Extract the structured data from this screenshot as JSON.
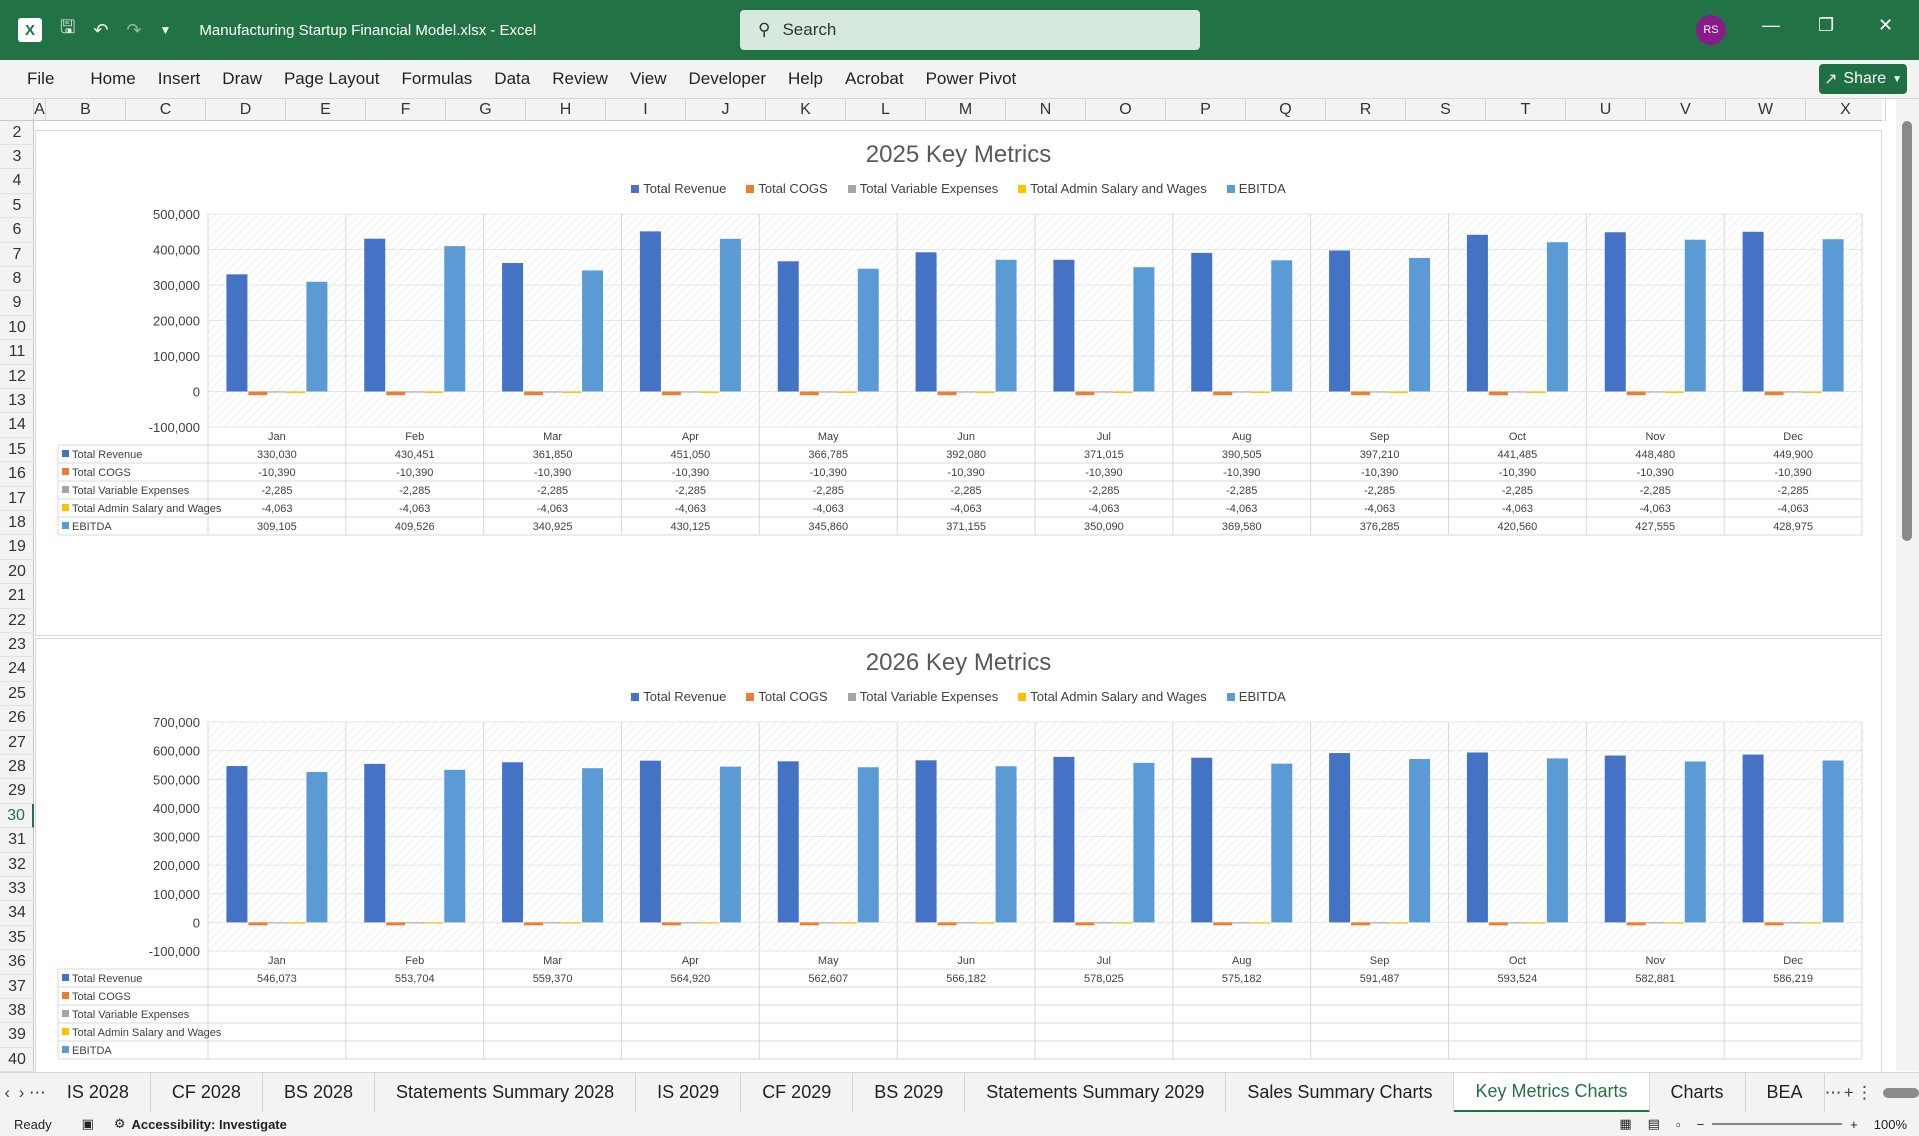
{
  "titlebar": {
    "file_title": "Manufacturing Startup Financial Model.xlsx  -  Excel",
    "search_placeholder": "Search",
    "avatar_initials": "RS"
  },
  "ribbon": {
    "tabs": [
      "File",
      "Home",
      "Insert",
      "Draw",
      "Page Layout",
      "Formulas",
      "Data",
      "Review",
      "View",
      "Developer",
      "Help",
      "Acrobat",
      "Power Pivot"
    ],
    "share_label": "Share"
  },
  "columns": [
    "A",
    "B",
    "C",
    "D",
    "E",
    "F",
    "G",
    "H",
    "I",
    "J",
    "K",
    "L",
    "M",
    "N",
    "O",
    "P",
    "Q",
    "R",
    "S",
    "T",
    "U",
    "V",
    "W",
    "X"
  ],
  "rows": [
    "2",
    "3",
    "4",
    "5",
    "6",
    "7",
    "8",
    "9",
    "10",
    "11",
    "12",
    "13",
    "14",
    "15",
    "16",
    "17",
    "18",
    "19",
    "20",
    "21",
    "22",
    "23",
    "24",
    "25",
    "26",
    "27",
    "28",
    "29",
    "30",
    "31",
    "32",
    "33",
    "34",
    "35",
    "36",
    "37",
    "38",
    "39",
    "40"
  ],
  "selected_row": "30",
  "colors": {
    "revenue": "#4472c4",
    "cogs": "#ed7d31",
    "variable": "#a5a5a5",
    "admin": "#ffc000",
    "ebitda": "#5b9bd5",
    "excel_green": "#217346"
  },
  "chart_data": [
    {
      "type": "bar",
      "title": "2025 Key Metrics",
      "categories": [
        "Jan",
        "Feb",
        "Mar",
        "Apr",
        "May",
        "Jun",
        "Jul",
        "Aug",
        "Sep",
        "Oct",
        "Nov",
        "Dec"
      ],
      "ylim": [
        -100000,
        500000
      ],
      "yticks": [
        "500,000",
        "400,000",
        "300,000",
        "200,000",
        "100,000",
        "0",
        "-100,000"
      ],
      "legend_position": "top",
      "series": [
        {
          "name": "Total Revenue",
          "values": [
            330030,
            430451,
            361850,
            451050,
            366785,
            392080,
            371015,
            390505,
            397210,
            441485,
            448480,
            449900
          ],
          "labels": [
            "330,030",
            "430,451",
            "361,850",
            "451,050",
            "366,785",
            "392,080",
            "371,015",
            "390,505",
            "397,210",
            "441,485",
            "448,480",
            "449,900"
          ]
        },
        {
          "name": "Total COGS",
          "values": [
            -10390,
            -10390,
            -10390,
            -10390,
            -10390,
            -10390,
            -10390,
            -10390,
            -10390,
            -10390,
            -10390,
            -10390
          ],
          "labels": [
            "-10,390",
            "-10,390",
            "-10,390",
            "-10,390",
            "-10,390",
            "-10,390",
            "-10,390",
            "-10,390",
            "-10,390",
            "-10,390",
            "-10,390",
            "-10,390"
          ]
        },
        {
          "name": "Total Variable Expenses",
          "values": [
            -2285,
            -2285,
            -2285,
            -2285,
            -2285,
            -2285,
            -2285,
            -2285,
            -2285,
            -2285,
            -2285,
            -2285
          ],
          "labels": [
            "-2,285",
            "-2,285",
            "-2,285",
            "-2,285",
            "-2,285",
            "-2,285",
            "-2,285",
            "-2,285",
            "-2,285",
            "-2,285",
            "-2,285",
            "-2,285"
          ]
        },
        {
          "name": "Total Admin Salary and Wages",
          "values": [
            -4063,
            -4063,
            -4063,
            -4063,
            -4063,
            -4063,
            -4063,
            -4063,
            -4063,
            -4063,
            -4063,
            -4063
          ],
          "labels": [
            "-4,063",
            "-4,063",
            "-4,063",
            "-4,063",
            "-4,063",
            "-4,063",
            "-4,063",
            "-4,063",
            "-4,063",
            "-4,063",
            "-4,063",
            "-4,063"
          ]
        },
        {
          "name": "EBITDA",
          "values": [
            309105,
            409526,
            340925,
            430125,
            345860,
            371155,
            350090,
            369580,
            376285,
            420560,
            427555,
            428975
          ],
          "labels": [
            "309,105",
            "409,526",
            "340,925",
            "430,125",
            "345,860",
            "371,155",
            "350,090",
            "369,580",
            "376,285",
            "420,560",
            "427,555",
            "428,975"
          ]
        }
      ]
    },
    {
      "type": "bar",
      "title": "2026 Key Metrics",
      "categories": [
        "Jan",
        "Feb",
        "Mar",
        "Apr",
        "May",
        "Jun",
        "Jul",
        "Aug",
        "Sep",
        "Oct",
        "Nov",
        "Dec"
      ],
      "ylim": [
        -100000,
        700000
      ],
      "yticks": [
        "700,000",
        "600,000",
        "500,000",
        "400,000",
        "300,000",
        "200,000",
        "100,000",
        "0",
        "-100,000"
      ],
      "legend_position": "top",
      "series": [
        {
          "name": "Total Revenue",
          "values": [
            546073,
            553704,
            559370,
            564920,
            562607,
            566182,
            578025,
            575182,
            591487,
            593524,
            582881,
            586219
          ],
          "labels": [
            "546,073",
            "553,704",
            "559,370",
            "564,920",
            "562,607",
            "566,182",
            "578,025",
            "575,182",
            "591,487",
            "593,524",
            "582,881",
            "586,219"
          ]
        },
        {
          "name": "Total COGS",
          "values": [
            -10390,
            -10390,
            -10390,
            -10390,
            -10390,
            -10390,
            -10390,
            -10390,
            -10390,
            -10390,
            -10390,
            -10390
          ],
          "labels": []
        },
        {
          "name": "Total Variable Expenses",
          "values": [
            -2285,
            -2285,
            -2285,
            -2285,
            -2285,
            -2285,
            -2285,
            -2285,
            -2285,
            -2285,
            -2285,
            -2285
          ],
          "labels": []
        },
        {
          "name": "Total Admin Salary and Wages",
          "values": [
            -4063,
            -4063,
            -4063,
            -4063,
            -4063,
            -4063,
            -4063,
            -4063,
            -4063,
            -4063,
            -4063,
            -4063
          ],
          "labels": []
        },
        {
          "name": "EBITDA",
          "values": [
            525335,
            532966,
            538632,
            544182,
            541869,
            545444,
            557287,
            554444,
            570749,
            572786,
            562143,
            565481
          ],
          "labels": []
        }
      ]
    }
  ],
  "sheet_tabs": [
    "IS 2028",
    "CF 2028",
    "BS 2028",
    "Statements Summary 2028",
    "IS 2029",
    "CF 2029",
    "BS 2029",
    "Statements Summary 2029",
    "Sales Summary Charts",
    "Key Metrics Charts",
    "Charts",
    "BEA"
  ],
  "active_sheet": "Key Metrics Charts",
  "status": {
    "ready": "Ready",
    "accessibility": "Accessibility: Investigate",
    "zoom": "100%"
  }
}
